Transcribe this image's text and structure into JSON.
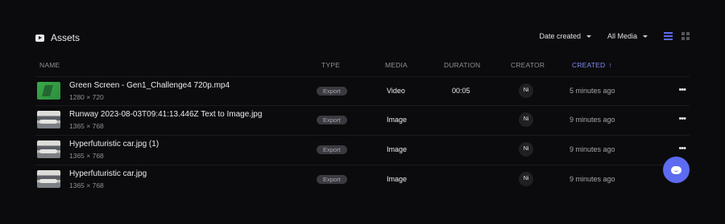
{
  "header": {
    "title": "Assets",
    "sort_label": "Date created",
    "filter_label": "All Media",
    "accent": "#5b6bf0"
  },
  "columns": {
    "name": "NAME",
    "type": "TYPE",
    "media": "MEDIA",
    "duration": "DURATION",
    "creator": "CREATOR",
    "created": "CREATED"
  },
  "rows": [
    {
      "name": "Green Screen - Gen1_Challenge4 720p.mp4",
      "dims": "1280 × 720",
      "type": "Export",
      "media": "Video",
      "duration": "00:05",
      "creator": "Ni",
      "time": "5 minutes ago",
      "thumb": "green"
    },
    {
      "name": "Runway 2023-08-03T09:41:13.446Z Text to Image.jpg",
      "dims": "1365 × 768",
      "type": "Export",
      "media": "Image",
      "duration": "",
      "creator": "Ni",
      "time": "9 minutes ago",
      "thumb": "car"
    },
    {
      "name": "Hyperfuturistic car.jpg (1)",
      "dims": "1365 × 768",
      "type": "Export",
      "media": "Image",
      "duration": "",
      "creator": "Ni",
      "time": "9 minutes ago",
      "thumb": "car"
    },
    {
      "name": "Hyperfuturistic car.jpg",
      "dims": "1365 × 768",
      "type": "Export",
      "media": "Image",
      "duration": "",
      "creator": "Ni",
      "time": "9 minutes ago",
      "thumb": "car"
    }
  ],
  "icons": {
    "more": "more-horizontal-icon",
    "chat": "chat-icon"
  }
}
